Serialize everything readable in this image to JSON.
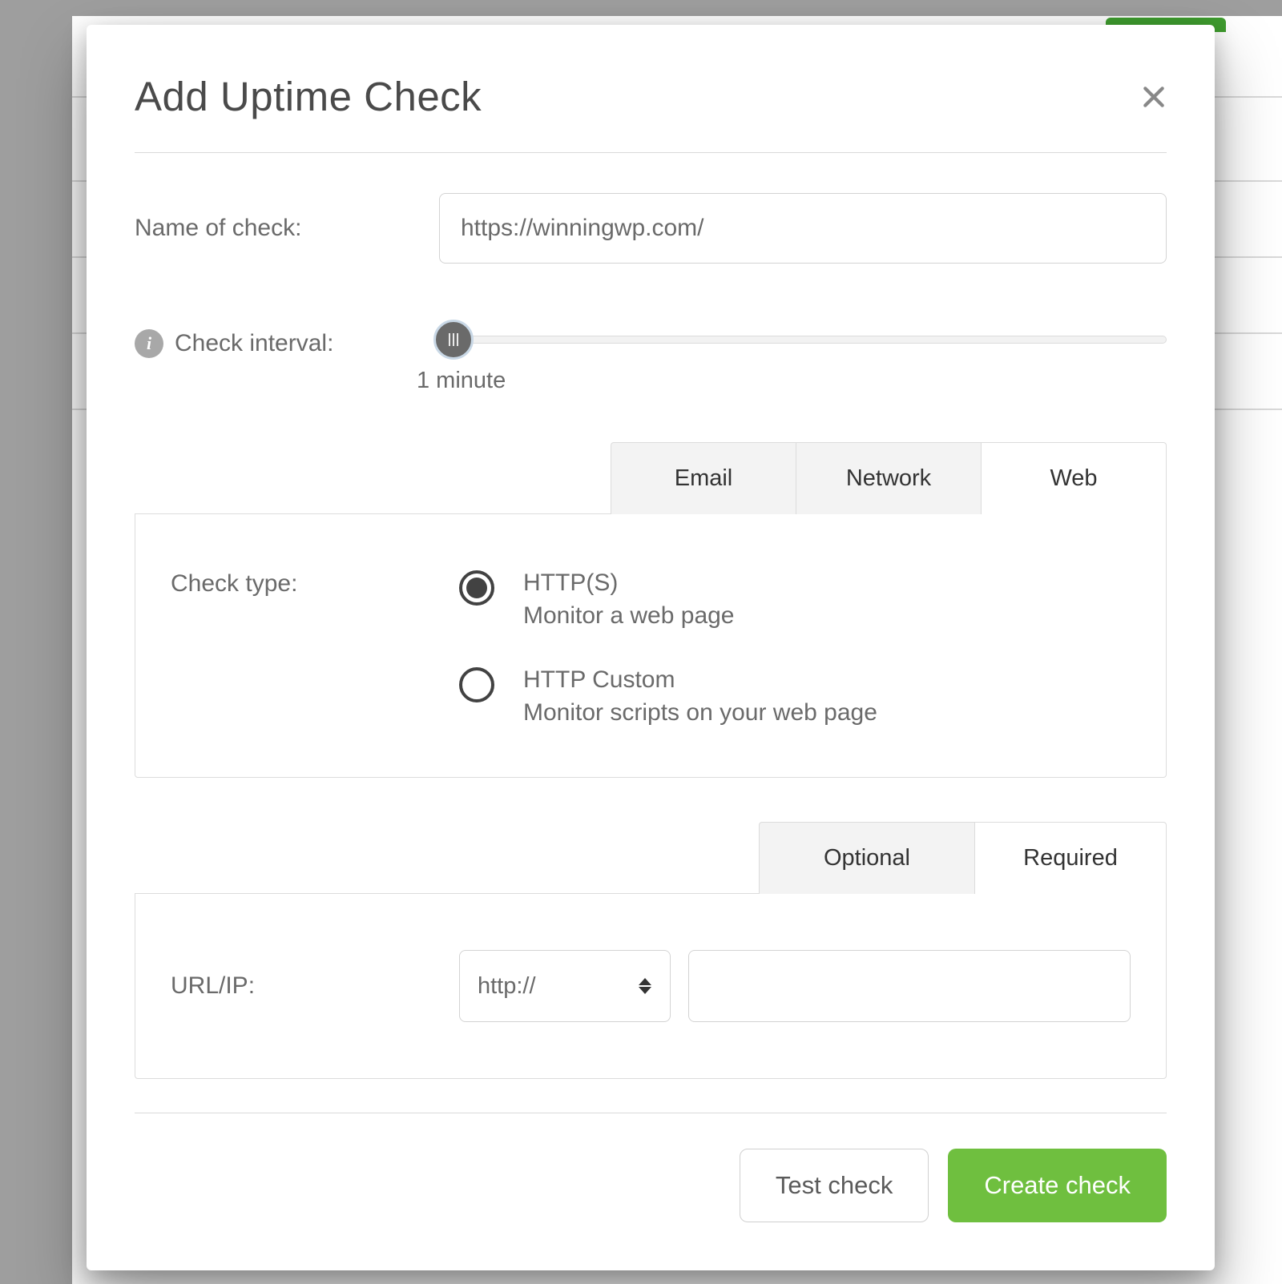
{
  "modal": {
    "title": "Add Uptime Check",
    "name_label": "Name of check:",
    "name_value": "https://winningwp.com/",
    "interval_label": "Check interval:",
    "interval_value": "1 minute",
    "tabs_top": {
      "email": "Email",
      "network": "Network",
      "web": "Web",
      "active": "web"
    },
    "check_type": {
      "label": "Check type:",
      "options": [
        {
          "title": "HTTP(S)",
          "subtitle": "Monitor a web page",
          "selected": true
        },
        {
          "title": "HTTP Custom",
          "subtitle": "Monitor scripts on your web page",
          "selected": false
        }
      ]
    },
    "tabs_bottom": {
      "optional": "Optional",
      "required": "Required",
      "active": "required"
    },
    "url_ip": {
      "label": "URL/IP:",
      "protocol": "http://",
      "value": ""
    },
    "footer": {
      "test": "Test check",
      "create": "Create check"
    }
  },
  "colors": {
    "primary_button": "#6fbf3f"
  }
}
